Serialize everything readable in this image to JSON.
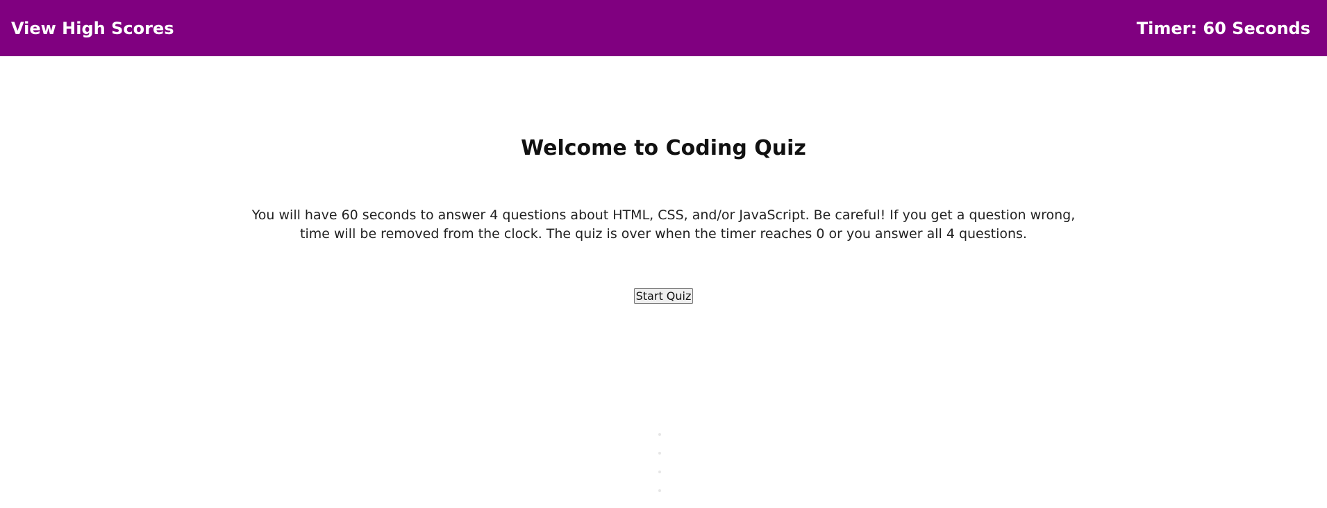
{
  "header": {
    "high_scores_label": "View High Scores",
    "timer_label": "Timer: 60 Seconds",
    "background_color": "#800080"
  },
  "main": {
    "title": "Welcome to Coding Quiz",
    "intro": "You will have 60 seconds to answer 4 questions about HTML, CSS, and/or JavaScript. Be careful! If you get a question wrong, time will be removed from the clock. The quiz is over when the timer reaches 0 or you answer all 4 questions.",
    "start_button_label": "Start Quiz"
  }
}
